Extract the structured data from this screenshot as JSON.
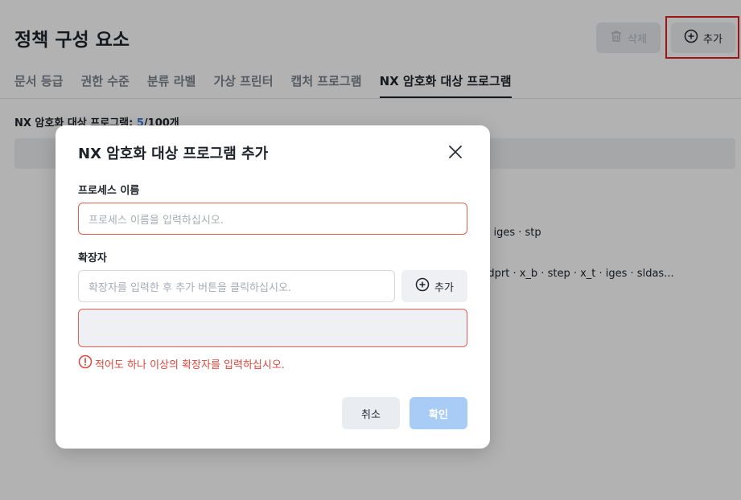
{
  "page": {
    "title": "정책 구성 요소",
    "delete_label": "삭제",
    "add_label": "추가",
    "tabs": [
      {
        "label": "문서 등급"
      },
      {
        "label": "권한 수준"
      },
      {
        "label": "분류 라벨"
      },
      {
        "label": "가상 프린터"
      },
      {
        "label": "캡처 프로그램"
      },
      {
        "label": "NX 암호화 대상 프로그램",
        "active": true
      }
    ],
    "count_label": "NX 암호화 대상 프로그램:",
    "count_current": "5",
    "count_max": "/100개",
    "rows": [
      {
        "text": "t · iges · stp"
      },
      {
        "text": "sldprt · x_b · step · x_t · iges · sldas..."
      }
    ]
  },
  "modal": {
    "title": "NX 암호화 대상 프로그램 추가",
    "process_label": "프로세스 이름",
    "process_placeholder": "프로세스 이름을 입력하십시오.",
    "extension_label": "확장자",
    "extension_placeholder": "확장자를 입력한 후 추가 버튼을 클릭하십시오.",
    "extension_add_label": "추가",
    "error_message": "적어도 하나 이상의 확장자를 입력하십시오.",
    "cancel_label": "취소",
    "confirm_label": "확인"
  },
  "colors": {
    "error": "#d9463b",
    "accent": "#3a7bd5",
    "confirm_disabled": "#a8ccf5",
    "highlight_box": "#e0201e"
  }
}
